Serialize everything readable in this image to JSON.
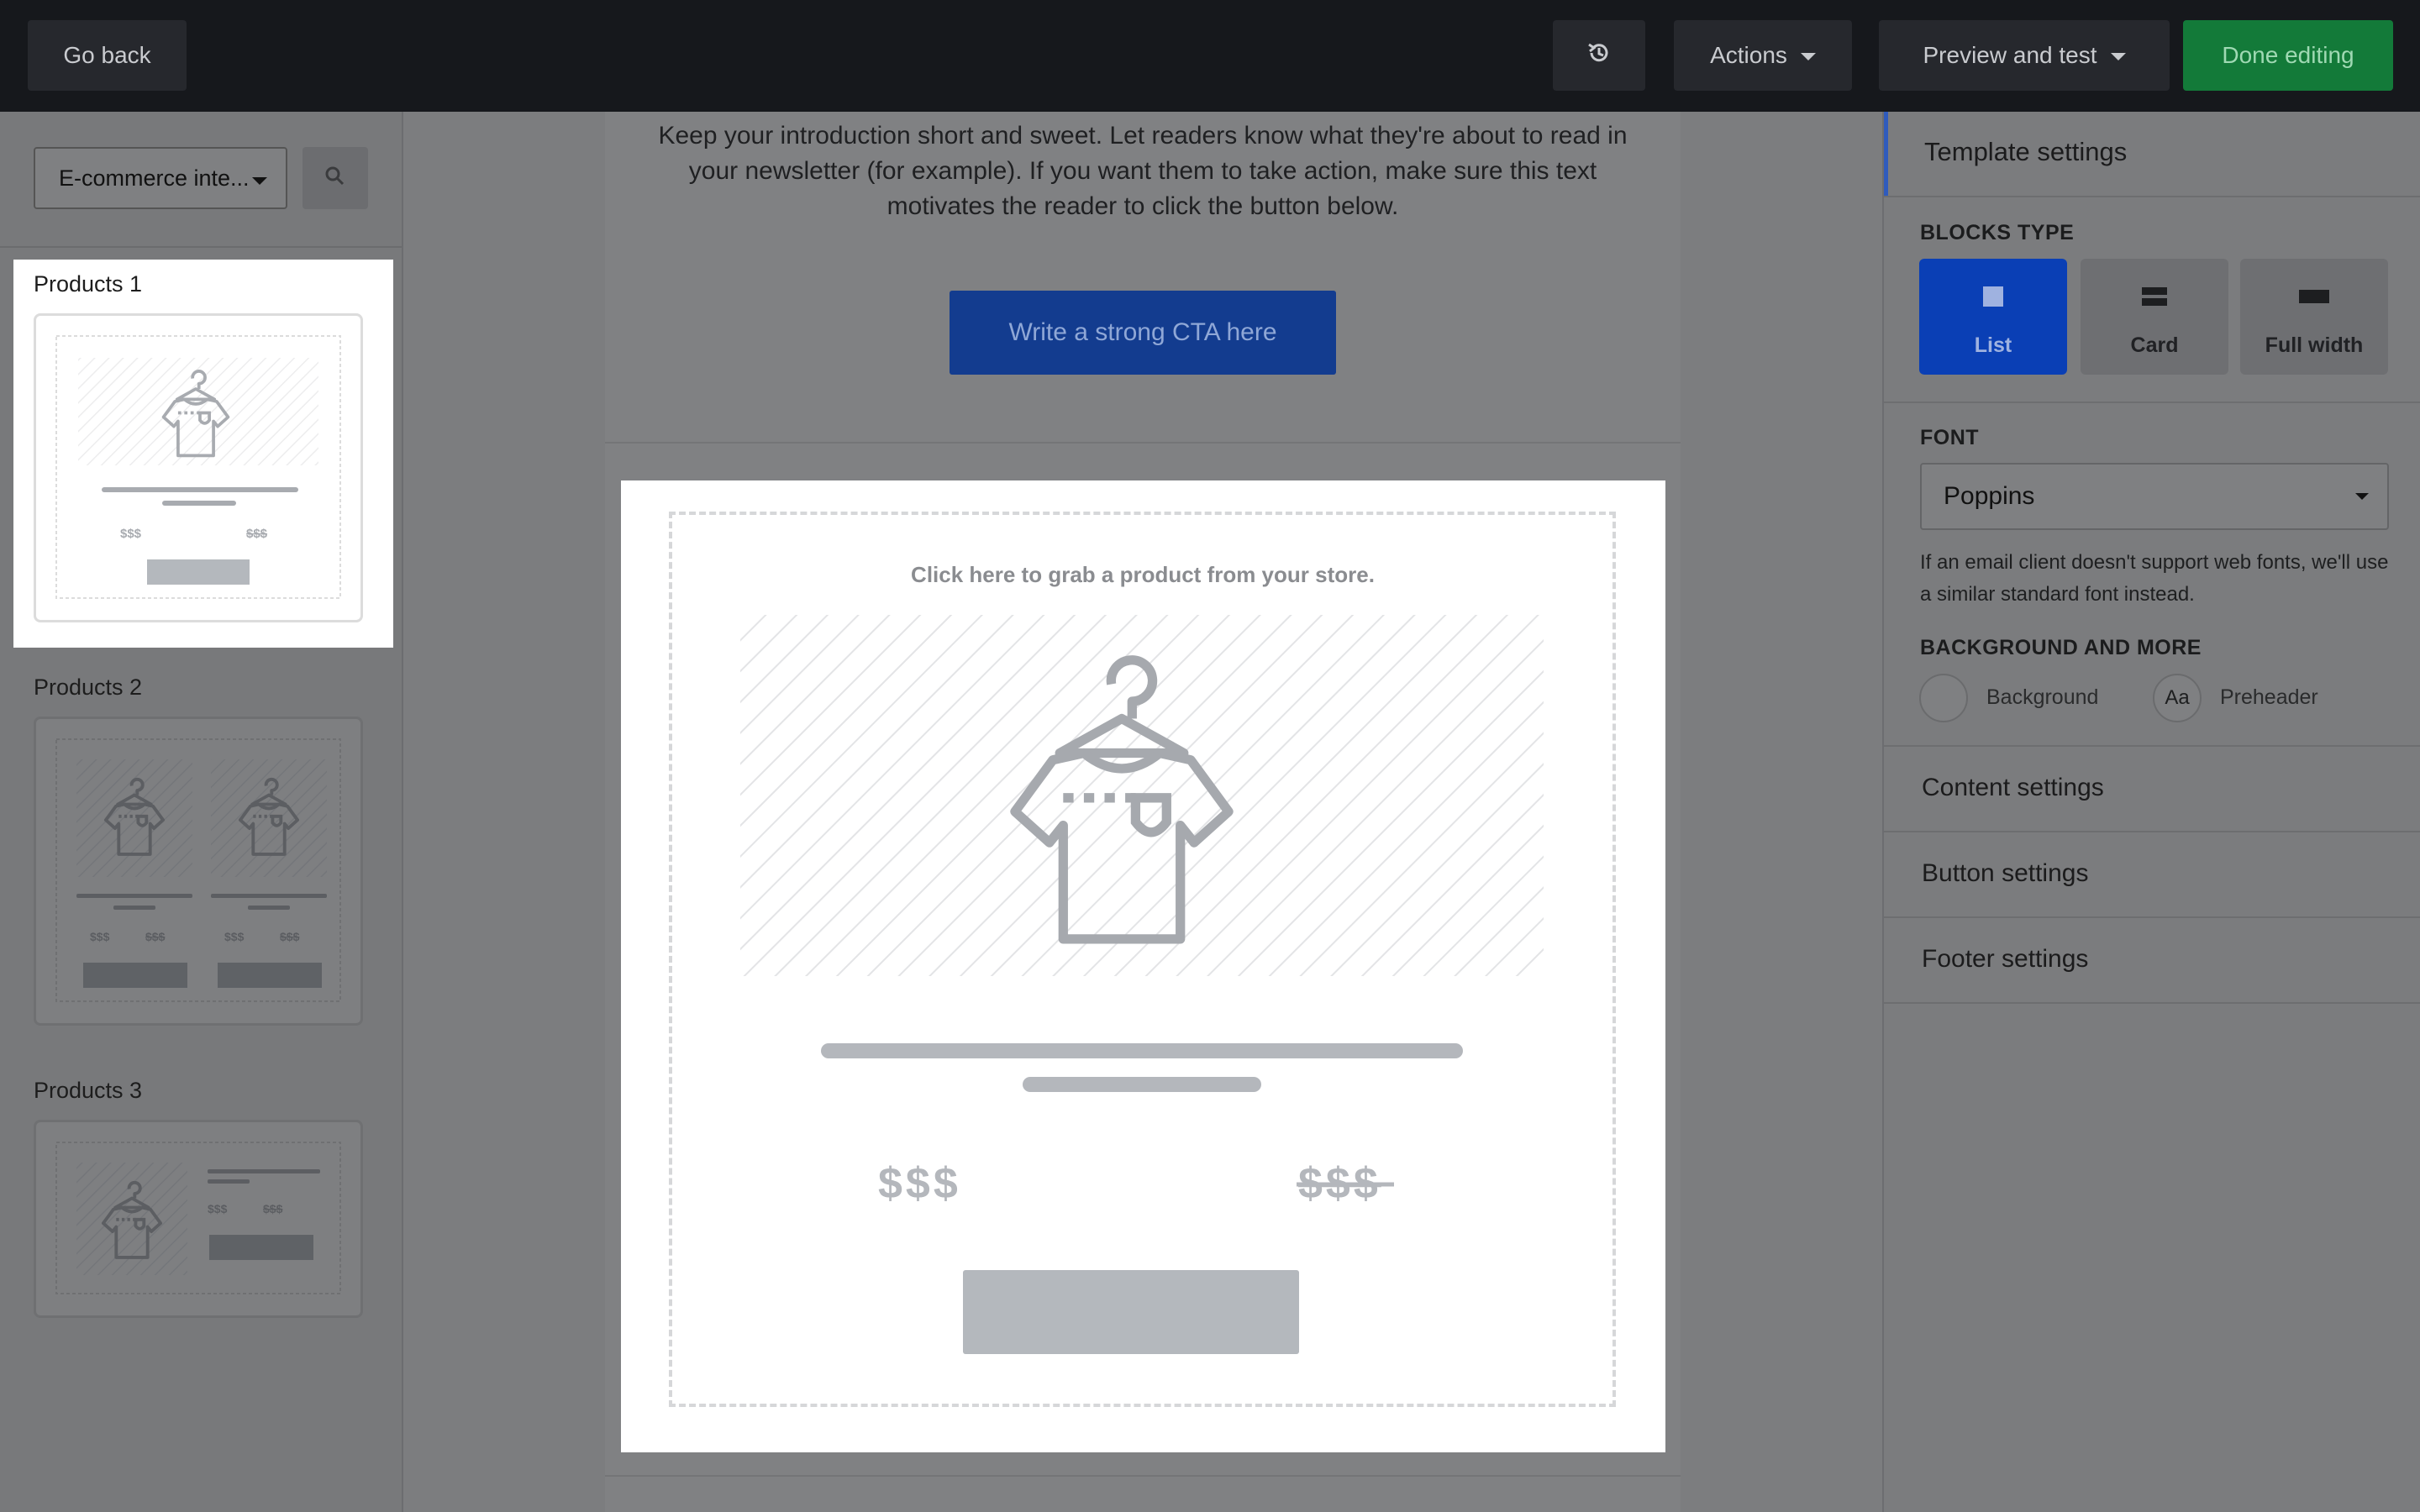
{
  "topbar": {
    "go_back": "Go back",
    "history_icon": "history-icon",
    "actions": "Actions",
    "preview": "Preview and test",
    "done": "Done editing"
  },
  "left": {
    "select_value": "E-commerce inte...",
    "search_icon": "search-icon",
    "products": [
      {
        "title": "Products 1"
      },
      {
        "title": "Products 2"
      },
      {
        "title": "Products 3"
      }
    ],
    "price": "$$$",
    "price_old": "$$$"
  },
  "canvas": {
    "intro": "Keep your introduction short and sweet. Let readers know what they're about to read in your newsletter (for example). If you want them to take action, make sure this text motivates the reader to click the button below.",
    "cta": "Write a strong CTA here",
    "grab": "Click here to grab a product from your store.",
    "price": "$$$",
    "price_old": "$$$"
  },
  "right": {
    "template_settings": "Template settings",
    "blocks_type_label": "BLOCKS TYPE",
    "blocks": [
      {
        "label": "List",
        "active": true
      },
      {
        "label": "Card",
        "active": false
      },
      {
        "label": "Full width",
        "active": false
      }
    ],
    "font_label": "FONT",
    "font_value": "Poppins",
    "font_note": "If an email client doesn't support web fonts, we'll use a similar standard font instead.",
    "bg_label": "BACKGROUND AND MORE",
    "background": "Background",
    "preheader_icon": "Aa",
    "preheader": "Preheader",
    "content_settings": "Content settings",
    "button_settings": "Button settings",
    "footer_settings": "Footer settings"
  },
  "colors": {
    "topbar": "#16181c",
    "done": "#137a39",
    "cta": "#133c8f",
    "active_block": "#0a3fb5",
    "accent_bar": "#2f5bbd"
  }
}
